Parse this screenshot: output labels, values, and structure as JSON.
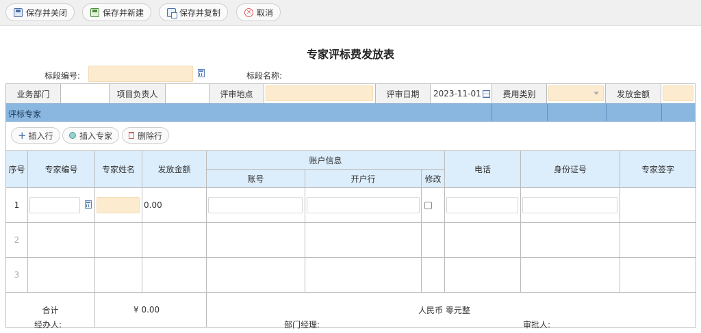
{
  "toolbar": {
    "save_close": "保存并关闭",
    "save_new": "保存并新建",
    "save_copy": "保存并复制",
    "cancel": "取消"
  },
  "title": "专家评标费发放表",
  "header": {
    "section_no_label": "标段编号:",
    "section_name_label": "标段名称:"
  },
  "info": {
    "dept_label": "业务部门",
    "pm_label": "项目负责人",
    "place_label": "评审地点",
    "date_label": "评审日期",
    "date_value": "2023-11-01",
    "fee_type_label": "费用类别",
    "amount_label": "发放金额"
  },
  "section_title": "评标专家",
  "actions": {
    "insert_row": "插入行",
    "insert_expert": "插入专家",
    "delete_row": "删除行"
  },
  "table": {
    "col_seq": "序号",
    "col_expert_no": "专家编号",
    "col_expert_name": "专家姓名",
    "col_amount": "发放金额",
    "col_account_info": "账户信息",
    "col_account_no": "账号",
    "col_bank": "开户行",
    "col_modify": "修改",
    "col_phone": "电话",
    "col_id": "身份证号",
    "col_sign": "专家签字",
    "rows": [
      {
        "seq": "1",
        "amount": "0.00"
      },
      {
        "seq": "2"
      },
      {
        "seq": "3"
      }
    ],
    "sum_label": "合计",
    "sum_value": "¥ 0.00",
    "rmb_label": "人民币",
    "rmb_value": "零元整"
  },
  "footer": {
    "handler": "经办人:",
    "manager": "部门经理:",
    "approver": "审批人:"
  },
  "colors": {
    "required_bg": "#fdebcf",
    "section_bar": "#8ab7e0",
    "header_bg": "#dcedfb"
  }
}
